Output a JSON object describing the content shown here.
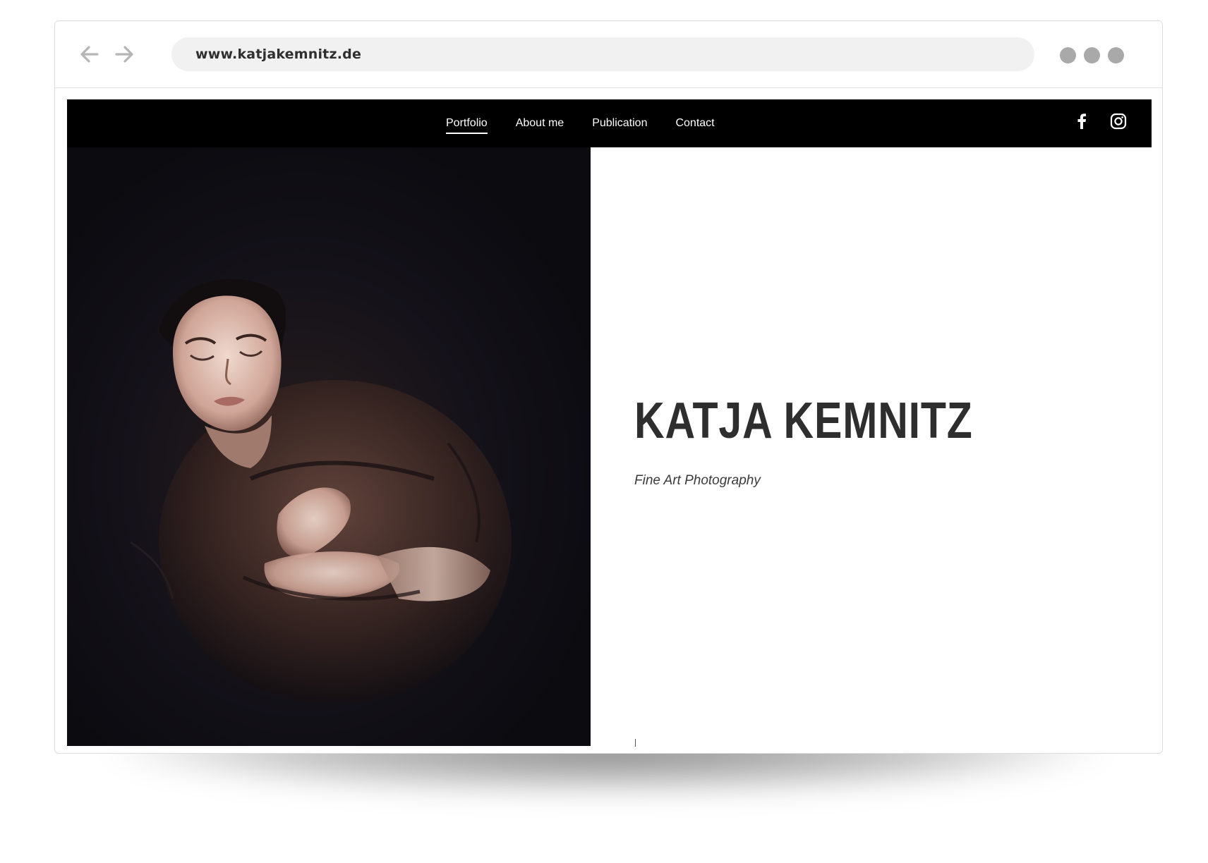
{
  "browser": {
    "url": "www.katjakemnitz.de",
    "back_icon": "arrow-left-icon",
    "forward_icon": "arrow-right-icon",
    "menu_icon": "three-dots-icon",
    "arrow_color": "#b5b5b5",
    "dot_color": "#a9a9a9"
  },
  "site": {
    "nav": {
      "items": [
        {
          "label": "Portfolio",
          "active": true
        },
        {
          "label": "About me",
          "active": false
        },
        {
          "label": "Publication",
          "active": false
        },
        {
          "label": "Contact",
          "active": false
        }
      ],
      "social": [
        "facebook-icon",
        "instagram-icon"
      ],
      "background": "#000000"
    },
    "hero": {
      "title": "KATJA KEMNITZ",
      "subtitle": "Fine Art Photography",
      "photo": "woman-floating-in-dark-water"
    }
  }
}
